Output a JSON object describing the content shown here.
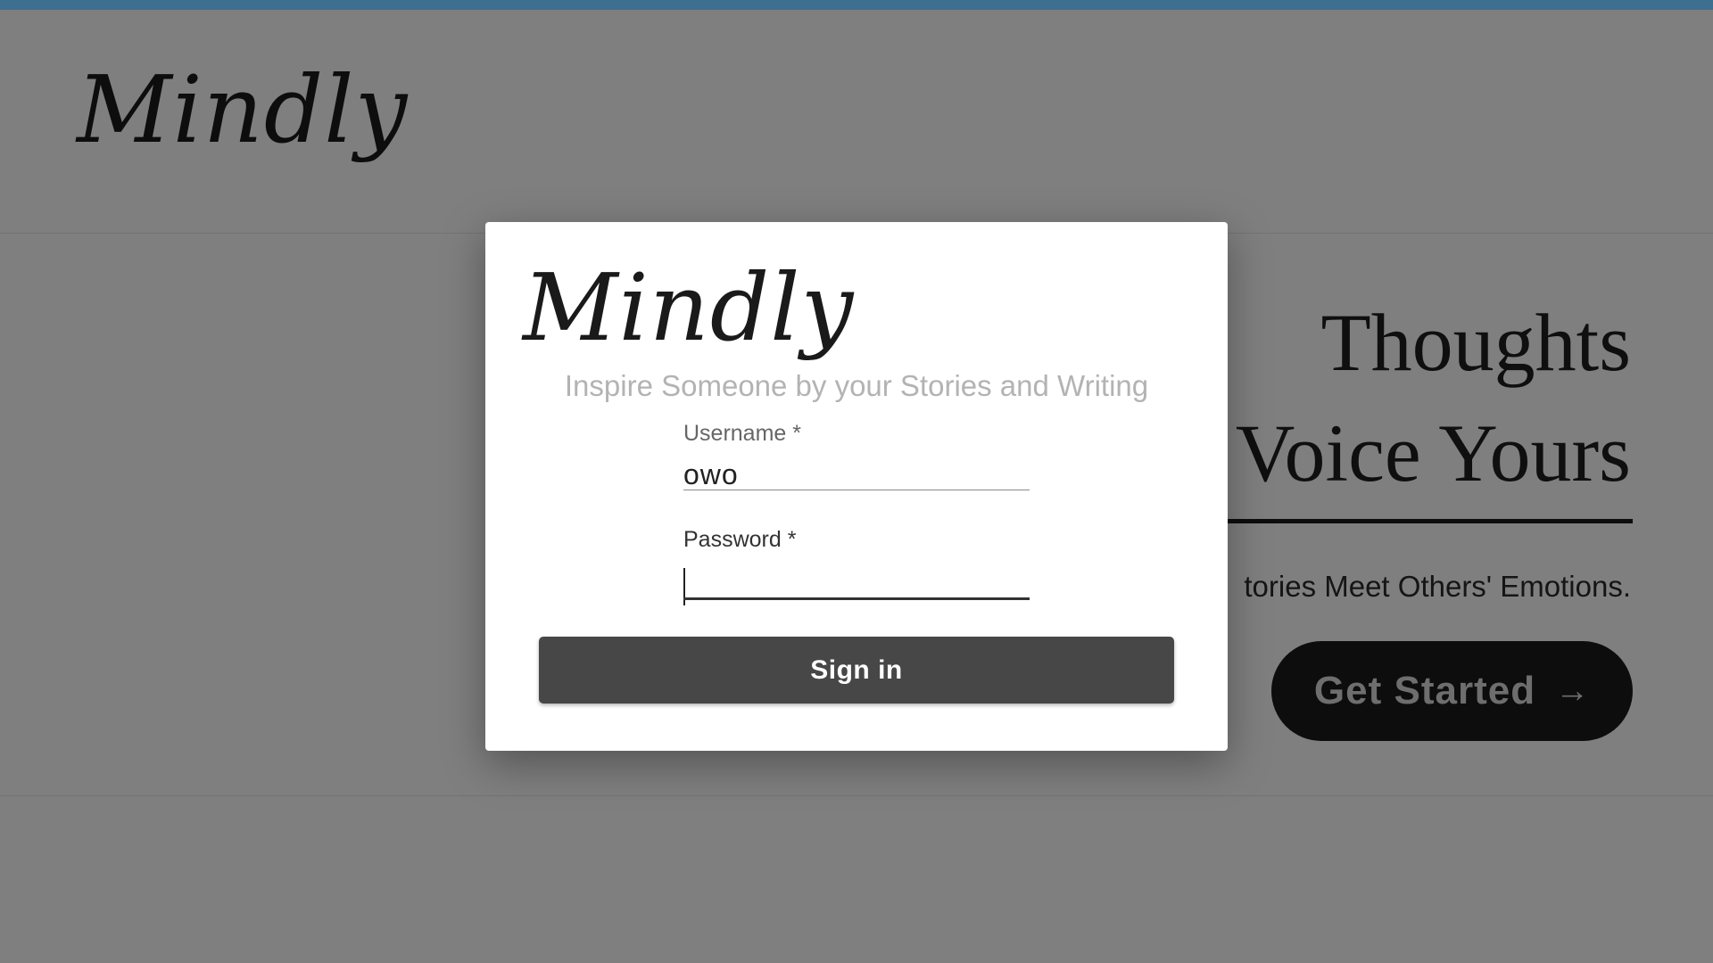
{
  "background": {
    "brand_logo": "Mindly",
    "hero": {
      "title_line1": "Thoughts",
      "title_line2": "Voice Yours",
      "subtitle": "tories Meet Others' Emotions.",
      "cta_label": "Get Started",
      "cta_icon": "arrow-right-icon"
    }
  },
  "modal": {
    "logo": "Mindly",
    "tagline": "Inspire Someone by your Stories and Writing",
    "username": {
      "label": "Username *",
      "value": "owo"
    },
    "password": {
      "label": "Password *",
      "value": ""
    },
    "signin_label": "Sign in"
  },
  "colors": {
    "top_strip": "#3d6f8f",
    "overlay": "rgba(0,0,0,0.5)",
    "signin_button": "#474747",
    "cta_button": "#1b1b1b"
  }
}
